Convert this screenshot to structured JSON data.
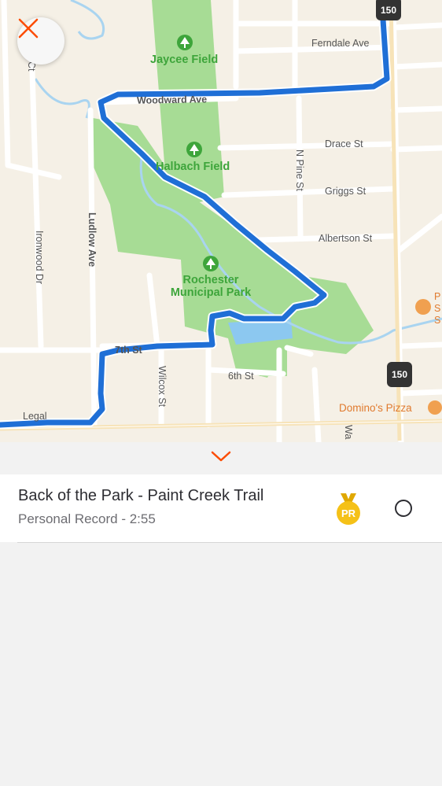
{
  "map": {
    "streets": {
      "ferndale": "Ferndale Ave",
      "woodward": "Woodward Ave",
      "drace": "Drace St",
      "griggs": "Griggs St",
      "albertson": "Albertson St",
      "n_pine": "N Pine St",
      "ludlow": "Ludlow Ave",
      "ironwood": "Ironwood Dr",
      "seventh": "7th St",
      "sixth": "6th St",
      "wilcox": "Wilcox St",
      "legal": "Legal",
      "ct_fragment": "Ct",
      "wa_fragment": "Wa"
    },
    "places": {
      "jaycee": "Jaycee Field",
      "halbach": "Halbach Field",
      "rochester_line1": "Rochester",
      "rochester_line2": "Municipal Park",
      "dominos": "Domino's Pizza",
      "poi_fragment": "P S S"
    },
    "route_shields": [
      "150",
      "150"
    ],
    "route_color": "#1f6fd6",
    "park_color": "#9ed98f"
  },
  "segment": {
    "name": "Back of the Park - Paint Creek Trail",
    "subtitle": "Personal Record - 2:55",
    "badge": "PR",
    "badge_color": "#f5c117"
  },
  "accent_color": "#fc4c02"
}
